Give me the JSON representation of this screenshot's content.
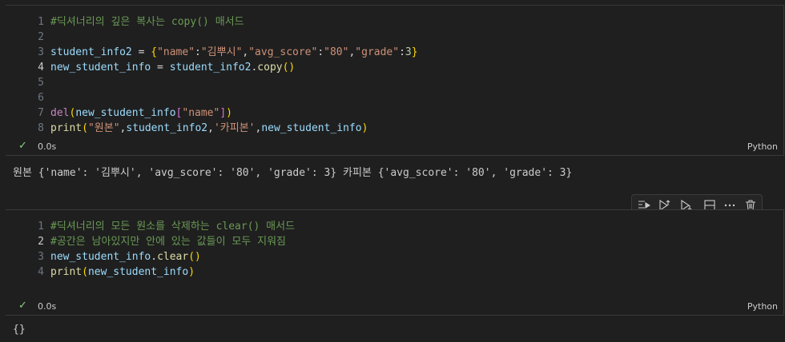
{
  "cell1": {
    "lines": [
      {
        "n": "1",
        "parts": [
          {
            "t": "#딕셔너리의 깊은 복사는 copy() 매서드",
            "c": "cm"
          }
        ]
      },
      {
        "n": "2",
        "parts": []
      },
      {
        "n": "3",
        "parts": [
          {
            "t": "student_info2",
            "c": "var"
          },
          {
            "t": " = ",
            "c": "op"
          },
          {
            "t": "{",
            "c": "br1"
          },
          {
            "t": "\"name\"",
            "c": "str"
          },
          {
            "t": ":",
            "c": "op"
          },
          {
            "t": "\"김뿌시\"",
            "c": "str"
          },
          {
            "t": ",",
            "c": "op"
          },
          {
            "t": "\"avg_score\"",
            "c": "str"
          },
          {
            "t": ":",
            "c": "op"
          },
          {
            "t": "\"80\"",
            "c": "str"
          },
          {
            "t": ",",
            "c": "op"
          },
          {
            "t": "\"grade\"",
            "c": "str"
          },
          {
            "t": ":",
            "c": "op"
          },
          {
            "t": "3",
            "c": "num"
          },
          {
            "t": "}",
            "c": "br1"
          }
        ]
      },
      {
        "n": "4",
        "active": true,
        "parts": [
          {
            "t": "new_student_info",
            "c": "var"
          },
          {
            "t": " = ",
            "c": "op"
          },
          {
            "t": "student_info2",
            "c": "var"
          },
          {
            "t": ".",
            "c": "op"
          },
          {
            "t": "copy",
            "c": "fn"
          },
          {
            "t": "()",
            "c": "br1"
          }
        ]
      },
      {
        "n": "5",
        "parts": []
      },
      {
        "n": "6",
        "parts": []
      },
      {
        "n": "7",
        "parts": [
          {
            "t": "del",
            "c": "kw"
          },
          {
            "t": "(",
            "c": "br1"
          },
          {
            "t": "new_student_info",
            "c": "var"
          },
          {
            "t": "[",
            "c": "br2"
          },
          {
            "t": "\"name\"",
            "c": "str"
          },
          {
            "t": "]",
            "c": "br2"
          },
          {
            "t": ")",
            "c": "br1"
          }
        ]
      },
      {
        "n": "8",
        "parts": [
          {
            "t": "print",
            "c": "fn"
          },
          {
            "t": "(",
            "c": "br1"
          },
          {
            "t": "\"원본\"",
            "c": "str"
          },
          {
            "t": ",",
            "c": "op"
          },
          {
            "t": "student_info2",
            "c": "var"
          },
          {
            "t": ",",
            "c": "op"
          },
          {
            "t": "'카피본'",
            "c": "str"
          },
          {
            "t": ",",
            "c": "op"
          },
          {
            "t": "new_student_info",
            "c": "var"
          },
          {
            "t": ")",
            "c": "br1"
          }
        ]
      }
    ],
    "time": "0.0s",
    "language": "Python",
    "output": "원본 {'name': '김뿌시', 'avg_score': '80', 'grade': 3} 카피본 {'avg_score': '80', 'grade': 3}"
  },
  "cell2": {
    "lines": [
      {
        "n": "1",
        "parts": [
          {
            "t": "#딕셔너리의 모든 원소를 삭제하는 clear() 매서드",
            "c": "cm"
          }
        ]
      },
      {
        "n": "2",
        "active": true,
        "parts": [
          {
            "t": "#공간은 남아있지만 안에 있는 값들이 모두 지워짐",
            "c": "cm"
          }
        ]
      },
      {
        "n": "3",
        "parts": [
          {
            "t": "new_student_info",
            "c": "var"
          },
          {
            "t": ".",
            "c": "op"
          },
          {
            "t": "clear",
            "c": "fn"
          },
          {
            "t": "()",
            "c": "br1"
          }
        ]
      },
      {
        "n": "4",
        "parts": [
          {
            "t": "print",
            "c": "fn"
          },
          {
            "t": "(",
            "c": "br1"
          },
          {
            "t": "new_student_info",
            "c": "var"
          },
          {
            "t": ")",
            "c": "br1"
          }
        ]
      }
    ],
    "time": "0.0s",
    "language": "Python",
    "output": "{}"
  },
  "toolbar": {
    "icons": [
      "run-by-line-icon",
      "execute-above-icon",
      "execute-below-icon",
      "split-cell-icon",
      "more-icon",
      "delete-icon"
    ]
  },
  "colors": {
    "background": "#1f1f1f",
    "comment": "#6a9955",
    "variable": "#9cdcfe",
    "string": "#ce9178",
    "number": "#b5cea8",
    "function": "#dcdcaa",
    "keyword": "#c586c0",
    "check": "#89d185"
  }
}
